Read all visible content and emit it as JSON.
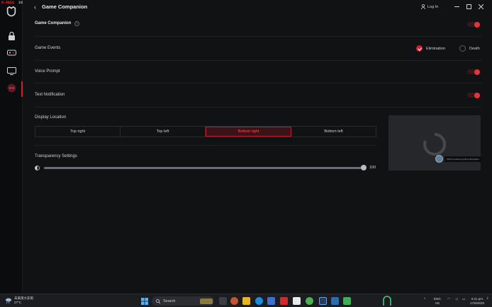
{
  "overlay": {
    "fps_label": "0.0111",
    "fps_value": "18"
  },
  "header": {
    "title": "Game Companion",
    "login": "Log In"
  },
  "rows": {
    "game_companion": {
      "label": "Game Companion"
    },
    "game_events": {
      "label": "Game Events",
      "options": [
        "Elimination",
        "Death"
      ]
    },
    "voice_prompt": {
      "label": "Voice Prompt"
    },
    "text_notification": {
      "label": "Text Notification"
    }
  },
  "display_location": {
    "label": "Display Location",
    "options": [
      "Top right",
      "Top left",
      "Bottom right",
      "Bottom left"
    ],
    "selected": "Bottom right"
  },
  "transparency": {
    "label": "Transparency Settings",
    "value": "100",
    "fraction": 1.0
  },
  "preview": {
    "notification_text": "CNKG Invasion perfect elimination"
  },
  "taskbar": {
    "weather_line1": "未来雨大非雨",
    "weather_line2": "27°C",
    "search": "Search",
    "lang_line1": "ENG",
    "lang_line2": "US",
    "time": "5:11 pm",
    "date": "17/6/2025"
  },
  "colors": {
    "accent": "#d81f2f",
    "background": "#111214",
    "rail": "#0b0c0e"
  }
}
